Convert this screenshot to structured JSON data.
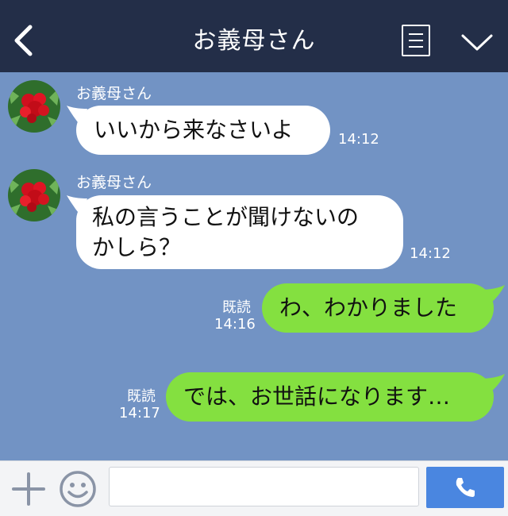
{
  "header": {
    "title": "お義母さん",
    "icons": [
      "chevron-left-icon",
      "menu-icon",
      "chevron-down-icon"
    ],
    "background": "#232e48"
  },
  "chat": {
    "background": "#7293c4",
    "messages": [
      {
        "direction": "incoming",
        "sender": "お義母さん",
        "lines": [
          "いいから来なさいよ"
        ],
        "time": "14:12"
      },
      {
        "direction": "incoming",
        "sender": "お義母さん",
        "lines": [
          "私の言うことが聞けないの",
          "かしら？"
        ],
        "time": "14:12"
      },
      {
        "direction": "outgoing",
        "status": "既読",
        "lines": [
          "わ、わかりました"
        ],
        "time": "14:16"
      },
      {
        "direction": "outgoing",
        "status": "既読",
        "lines": [
          "では、お世話になります…"
        ],
        "time": "14:17"
      }
    ],
    "colors": {
      "incoming_bubble": "#ffffff",
      "outgoing_bubble": "#84e040"
    }
  },
  "footer": {
    "input_value": "",
    "icons": [
      "plus-icon",
      "smiley-icon",
      "phone-icon"
    ],
    "call_button_color": "#4a86e0"
  }
}
